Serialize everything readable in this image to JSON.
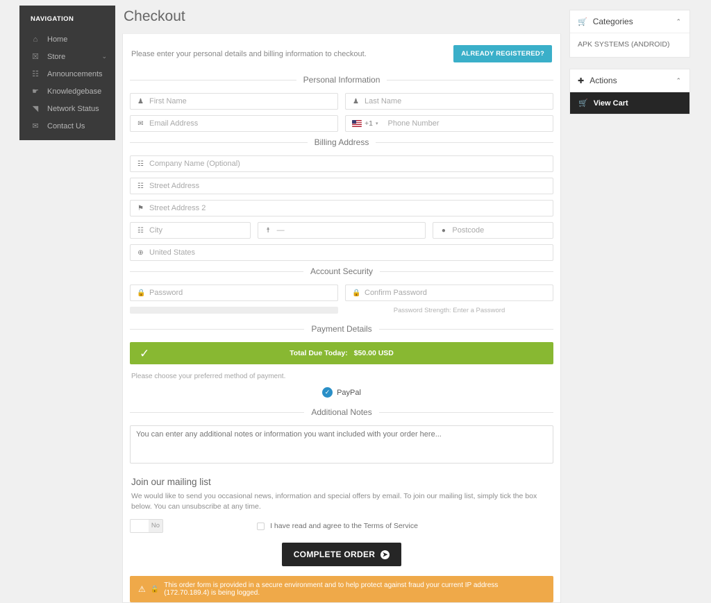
{
  "sidebar": {
    "title": "NAVIGATION",
    "items": [
      {
        "label": "Home",
        "icon": "home-icon",
        "glyph": "⌂",
        "chevron": ""
      },
      {
        "label": "Store",
        "icon": "store-icon",
        "glyph": "☒",
        "chevron": "⌄"
      },
      {
        "label": "Announcements",
        "icon": "megaphone-icon",
        "glyph": "☷",
        "chevron": ""
      },
      {
        "label": "Knowledgebase",
        "icon": "book-icon",
        "glyph": "☛",
        "chevron": ""
      },
      {
        "label": "Network Status",
        "icon": "signal-icon",
        "glyph": "◥",
        "chevron": ""
      },
      {
        "label": "Contact Us",
        "icon": "envelope-icon",
        "glyph": "✉",
        "chevron": ""
      }
    ]
  },
  "header": {
    "title": "Checkout"
  },
  "intro": {
    "text": "Please enter your personal details and billing information to checkout.",
    "registered_button": "ALREADY REGISTERED?"
  },
  "sections": {
    "personal": "Personal Information",
    "billing": "Billing Address",
    "security": "Account Security",
    "payment": "Payment Details",
    "notes": "Additional Notes"
  },
  "fields": {
    "first_name": {
      "placeholder": "First Name",
      "value": "",
      "icon": "person-icon",
      "glyph": "♟"
    },
    "last_name": {
      "placeholder": "Last Name",
      "value": "",
      "icon": "person-icon",
      "glyph": "♟"
    },
    "email": {
      "placeholder": "Email Address",
      "value": "",
      "icon": "envelope-icon",
      "glyph": "✉"
    },
    "phone": {
      "placeholder": "Phone Number",
      "value": "",
      "icon": "flag-icon",
      "country_code": "+1"
    },
    "company": {
      "placeholder": "Company Name (Optional)",
      "value": "",
      "icon": "building-icon",
      "glyph": "☷"
    },
    "street": {
      "placeholder": "Street Address",
      "value": "",
      "icon": "building-icon",
      "glyph": "☷"
    },
    "street2": {
      "placeholder": "Street Address 2",
      "value": "",
      "icon": "map-pin-icon",
      "glyph": "⚑"
    },
    "city": {
      "placeholder": "City",
      "value": "",
      "icon": "building-icon",
      "glyph": "☷"
    },
    "state": {
      "placeholder": "—",
      "value": "",
      "icon": "bank-icon",
      "glyph": "☨"
    },
    "postcode": {
      "placeholder": "Postcode",
      "value": "",
      "icon": "circle-icon",
      "glyph": "●"
    },
    "country": {
      "placeholder": "United States",
      "value": "United States",
      "icon": "globe-icon",
      "glyph": "⊕"
    },
    "password": {
      "placeholder": "Password",
      "value": "",
      "icon": "lock-icon",
      "glyph": "ὑ2"
    },
    "confirm_password": {
      "placeholder": "Confirm Password",
      "value": "",
      "icon": "lock-icon",
      "glyph": "ὑ2"
    },
    "notes": {
      "placeholder": "You can enter any additional notes or information you want included with your order here...",
      "value": ""
    }
  },
  "password_strength": "Password Strength: Enter a Password",
  "total": {
    "label": "Total Due Today:",
    "amount": "$50.00 USD",
    "check_glyph": "✓"
  },
  "payment": {
    "prompt": "Please choose your preferred method of payment.",
    "method": "PayPal",
    "selected": true
  },
  "mailing": {
    "title": "Join our mailing list",
    "description": "We would like to send you occasional news, information and special offers by email. To join our mailing list, simply tick the box below. You can unsubscribe at any time.",
    "toggle_value": "No"
  },
  "tos": {
    "label": "I have read and agree to the Terms of Service",
    "checked": false
  },
  "cta": {
    "label": "COMPLETE ORDER",
    "arrow": "➜"
  },
  "warning": {
    "text": "This order form is provided in a secure environment and to help protect against fraud your current IP address (172.70.189.4) is being logged.",
    "ip": "172.70.189.4",
    "warn_glyph": "⚠",
    "lock_glyph": "ὑ2"
  },
  "right_sidebar": {
    "categories": {
      "title": "Categories",
      "icon": "cart-icon",
      "collapse_glyph": "⌃",
      "items": [
        "APK SYSTEMS (ANDROID)"
      ]
    },
    "actions": {
      "title": "Actions",
      "icon": "plus-icon",
      "collapse_glyph": "⌃",
      "view_cart": "View Cart"
    }
  },
  "colors": {
    "accent_teal": "#3aafc9",
    "success_green": "#88b832",
    "warning_orange": "#efa949",
    "dark": "#262626",
    "sidebar_dark": "#3a3a3a",
    "paypal_blue": "#2a8fc7"
  }
}
